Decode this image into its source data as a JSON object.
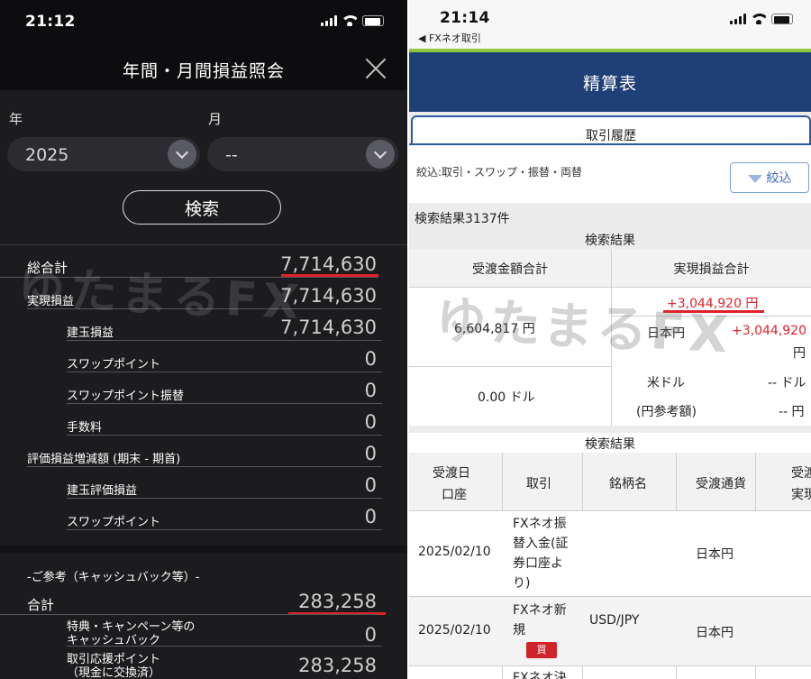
{
  "left": {
    "status_time": "21:12",
    "title": "年間・月間損益照会",
    "year_label": "年",
    "month_label": "月",
    "year_value": "2025",
    "month_value": "--",
    "search_label": "検索",
    "rows": [
      {
        "label": "総合計",
        "value": "7,714,630"
      },
      {
        "label": "実現損益",
        "value": "7,714,630"
      },
      {
        "label": "建玉損益",
        "value": "7,714,630"
      },
      {
        "label": "スワップポイント",
        "value": "0"
      },
      {
        "label": "スワップポイント振替",
        "value": "0"
      },
      {
        "label": "手数料",
        "value": "0"
      },
      {
        "label": "評価損益増減額 (期末 - 期首)",
        "value": "0"
      },
      {
        "label": "建玉評価損益",
        "value": "0"
      },
      {
        "label": "スワップポイント",
        "value": "0"
      }
    ],
    "ref_header": "-ご参考（キャッシュバック等）-",
    "ref_rows": [
      {
        "label": "合計",
        "value": "283,258"
      },
      {
        "label": "特典・キャンペーン等の",
        "label2": "キャッシュバック",
        "value": "0"
      },
      {
        "label": "取引応援ポイント",
        "label2": "（現金に交換済）",
        "value": "283,258"
      }
    ],
    "watermark": "ゆたまるFX"
  },
  "right": {
    "status_time": "21:14",
    "back_label": "◀ FXネオ取引",
    "title": "精算表",
    "tab_label": "取引履歴",
    "filter_text": "絞込:取引・スワップ・振替・両替",
    "filter_button": "絞込",
    "result_count": "検索結果3137件",
    "summary": {
      "section_title": "検索結果",
      "col1_header": "受渡金額合計",
      "col2_header": "実現損益合計",
      "total_jpy_amount": "6,604,817 円",
      "total_usd_amount": "0.00 ドル",
      "pl_total": "+3,044,920 円",
      "jpy_label": "日本円",
      "jpy_value": "+3,044,920",
      "jpy_unit": "円",
      "usd_label": "米ドル",
      "usd_value": "-- ドル",
      "ref_label": "(円参考額)",
      "ref_value": "-- 円"
    },
    "detail": {
      "section_title": "検索結果",
      "headers": [
        "受渡日",
        "口座",
        "取引",
        "銘柄名",
        "受渡通貨",
        "受渡",
        "実現"
      ],
      "rows": [
        {
          "date": "2025/02/10",
          "trade": [
            "FXネオ振",
            "替入金(証",
            "券口座よ",
            "り)"
          ],
          "symbol": "",
          "currency": "日本円"
        },
        {
          "date": "2025/02/10",
          "trade": [
            "FXネオ新",
            "規"
          ],
          "symbol": "USD/JPY",
          "currency": "日本円",
          "badge": "買"
        },
        {
          "trade": [
            "FXネオ決"
          ]
        }
      ]
    },
    "watermark": "ゆたまるFX"
  }
}
